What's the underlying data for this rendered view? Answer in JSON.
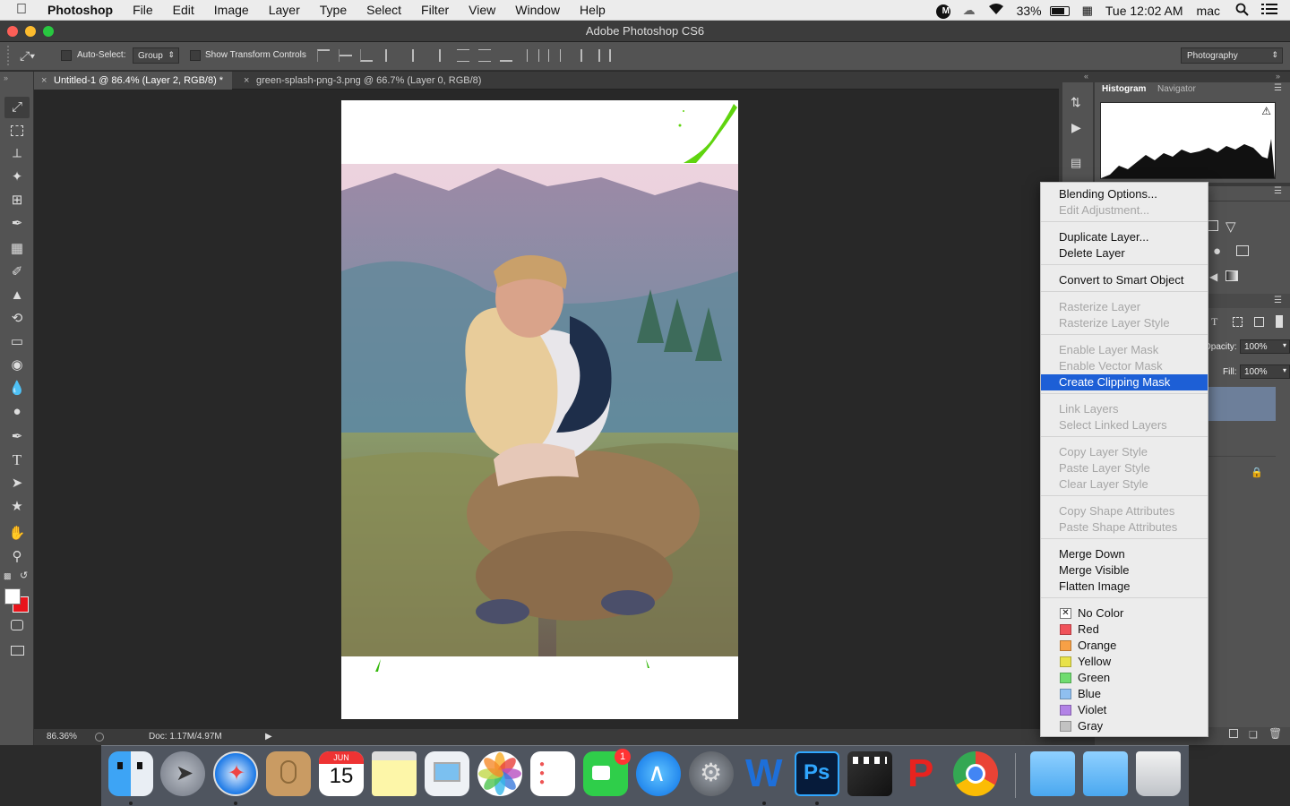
{
  "menubar": {
    "apple": "",
    "app": "Photoshop",
    "items": [
      "File",
      "Edit",
      "Image",
      "Layer",
      "Type",
      "Select",
      "Filter",
      "View",
      "Window",
      "Help"
    ],
    "battery": "33%",
    "clock": "Tue 12:02 AM",
    "user": "mac"
  },
  "window": {
    "title": "Adobe Photoshop CS6"
  },
  "options": {
    "auto_select_label": "Auto-Select:",
    "auto_select_value": "Group",
    "transform_label": "Show Transform Controls",
    "workspace_value": "Photography"
  },
  "tabs": [
    {
      "label": "Untitled-1 @ 86.4% (Layer 2, RGB/8) *",
      "active": true
    },
    {
      "label": "green-splash-png-3.png @ 66.7% (Layer 0, RGB/8)",
      "active": false
    }
  ],
  "status": {
    "zoom": "86.36%",
    "doc": "Doc: 1.17M/4.97M"
  },
  "panels": {
    "histogram_tab": "Histogram",
    "navigator_tab": "Navigator",
    "opacity_label": "Opacity:",
    "opacity_value": "100%",
    "fill_label": "Fill:",
    "fill_value": "100%"
  },
  "context_menu": {
    "groups": [
      [
        {
          "label": "Blending Options...",
          "enabled": true
        },
        {
          "label": "Edit Adjustment...",
          "enabled": false
        }
      ],
      [
        {
          "label": "Duplicate Layer...",
          "enabled": true
        },
        {
          "label": "Delete Layer",
          "enabled": true
        }
      ],
      [
        {
          "label": "Convert to Smart Object",
          "enabled": true
        }
      ],
      [
        {
          "label": "Rasterize Layer",
          "enabled": false
        },
        {
          "label": "Rasterize Layer Style",
          "enabled": false
        }
      ],
      [
        {
          "label": "Enable Layer Mask",
          "enabled": false
        },
        {
          "label": "Enable Vector Mask",
          "enabled": false
        },
        {
          "label": "Create Clipping Mask",
          "enabled": true,
          "highlighted": true
        }
      ],
      [
        {
          "label": "Link Layers",
          "enabled": false
        },
        {
          "label": "Select Linked Layers",
          "enabled": false
        }
      ],
      [
        {
          "label": "Copy Layer Style",
          "enabled": false
        },
        {
          "label": "Paste Layer Style",
          "enabled": false
        },
        {
          "label": "Clear Layer Style",
          "enabled": false
        }
      ],
      [
        {
          "label": "Copy Shape Attributes",
          "enabled": false
        },
        {
          "label": "Paste Shape Attributes",
          "enabled": false
        }
      ],
      [
        {
          "label": "Merge Down",
          "enabled": true
        },
        {
          "label": "Merge Visible",
          "enabled": true
        },
        {
          "label": "Flatten Image",
          "enabled": true
        }
      ]
    ],
    "colors": [
      {
        "label": "No Color",
        "swatch": "none"
      },
      {
        "label": "Red",
        "swatch": "#f0525a"
      },
      {
        "label": "Orange",
        "swatch": "#f7a046"
      },
      {
        "label": "Yellow",
        "swatch": "#e8e24a"
      },
      {
        "label": "Green",
        "swatch": "#6fdc6f"
      },
      {
        "label": "Blue",
        "swatch": "#8fbff0"
      },
      {
        "label": "Violet",
        "swatch": "#b282e6"
      },
      {
        "label": "Gray",
        "swatch": "#c2c2c2"
      }
    ]
  },
  "dock": {
    "calendar_month": "JUN",
    "calendar_day": "15",
    "facetime_badge": "1",
    "ps_label": "Ps"
  },
  "colors": {
    "highlight": "#1d5fd6",
    "panel": "#535353",
    "workspace": "#282828"
  }
}
